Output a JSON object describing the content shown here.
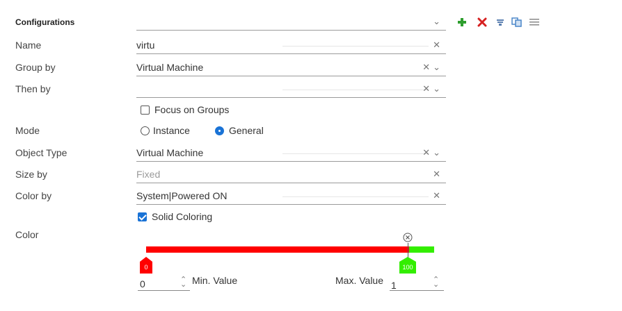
{
  "header": {
    "title": "Configurations",
    "config_select_value": ""
  },
  "toolbar": {
    "icons": [
      "add-icon",
      "delete-icon",
      "filter-icon",
      "copy-icon",
      "menu-icon"
    ]
  },
  "form": {
    "name": {
      "label": "Name",
      "value": "virtu"
    },
    "group_by": {
      "label": "Group by",
      "value": "Virtual Machine"
    },
    "then_by": {
      "label": "Then by",
      "value": ""
    },
    "focus_groups": {
      "label": "Focus on Groups",
      "checked": false
    },
    "mode": {
      "label": "Mode",
      "options": [
        "Instance",
        "General"
      ],
      "selected": "General"
    },
    "object_type": {
      "label": "Object Type",
      "value": "Virtual Machine"
    },
    "size_by": {
      "label": "Size by",
      "placeholder": "Fixed"
    },
    "color_by": {
      "label": "Color by",
      "value": "System|Powered ON"
    },
    "solid_coloring": {
      "label": "Solid Coloring",
      "checked": true
    },
    "color": {
      "label": "Color"
    }
  },
  "color_scale": {
    "min_marker": "0",
    "max_marker": "100",
    "min_color": "#ff0000",
    "max_color": "#33ee00",
    "min_value": "0",
    "min_value_label": "Min. Value",
    "max_value_label": "Max. Value",
    "max_value": "1"
  },
  "colors": {
    "accent": "#1a73d6",
    "add": "#2e9e2e",
    "delete": "#d62020"
  }
}
